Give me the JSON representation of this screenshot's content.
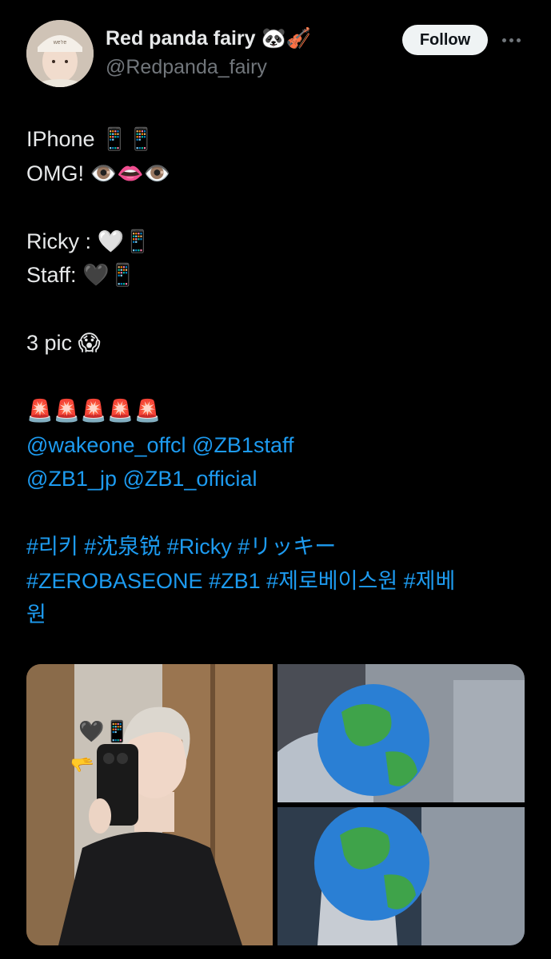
{
  "author": {
    "display_name": "Red panda fairy",
    "name_emojis": "🐼🎻",
    "handle": "@Redpanda_fairy",
    "avatar_icon": "profile-photo-icon"
  },
  "follow_button_label": "Follow",
  "more_icon": "more-options-icon",
  "post": {
    "line1": "IPhone 📱📱",
    "line2": "OMG! 👁️👄👁️",
    "line3": "Ricky : 🤍📱",
    "line4": "Staff: 🖤📱",
    "line5": "3 pic 😱",
    "line6": "🚨🚨🚨🚨🚨",
    "mentions_line1": "@wakeone_offcl @ZB1staff",
    "mentions_line2": "@ZB1_jp @ZB1_official",
    "hashtags_line1": "#리키 #沈泉锐 #Ricky #リッキー",
    "hashtags_line2": "#ZEROBASEONE  #ZB1 #제로베이스원 #제베",
    "hashtags_line3": "원"
  },
  "media": {
    "photo1_overlay": "🖤📱",
    "photo1_pointer": "🫳",
    "globe_icon": "🌎"
  },
  "colors": {
    "background": "#000000",
    "text": "#e7e9ea",
    "secondary_text": "#71767b",
    "link": "#1d9bf0",
    "follow_bg": "#eff3f4"
  }
}
